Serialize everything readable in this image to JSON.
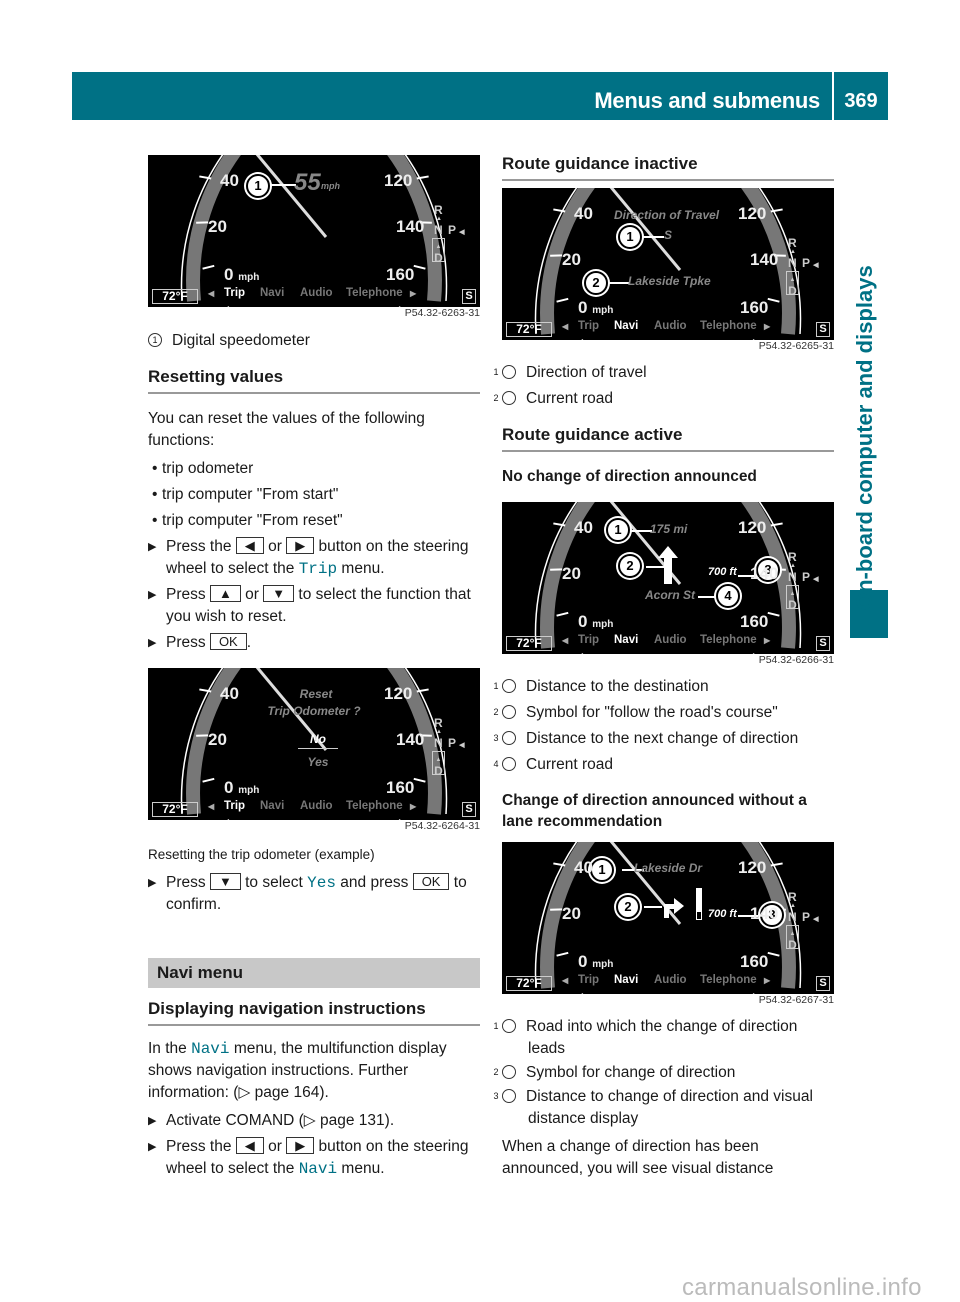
{
  "header": {
    "title": "Menus and submenus",
    "page": "369"
  },
  "side_tab": {
    "label": "On-board computer and displays"
  },
  "dashboard_common": {
    "ticks": {
      "left": [
        "40",
        "20",
        "0"
      ],
      "right": [
        "120",
        "140",
        "160"
      ],
      "unit": "mph"
    },
    "temperature": "72°F",
    "menu": [
      "Trip",
      "Navi",
      "Audio",
      "Telephone"
    ],
    "gear": {
      "r": "R",
      "n": "N",
      "p": "P",
      "d": "D"
    },
    "s_label": "S"
  },
  "left": {
    "fig1": {
      "code": "P54.32-6263-31",
      "active_menu": "Trip",
      "speed": "55",
      "speed_unit": "mph",
      "callouts": [
        "1"
      ]
    },
    "fig1_legend": [
      {
        "num": "1",
        "text": "Digital speedometer"
      }
    ],
    "resetting": {
      "heading": "Resetting values",
      "intro": "You can reset the values of the following functions:",
      "bullets": [
        "trip odometer",
        "trip computer \"From start\"",
        "trip computer \"From reset\""
      ],
      "step1": {
        "pre": "Press the",
        "key_left": "◀",
        "or": "or",
        "key_right": "▶",
        "post": "button on the steering wheel to select the",
        "menu": "Trip",
        "end": "menu."
      },
      "step2": {
        "pre": "Press",
        "key_up": "▲",
        "or": "or",
        "key_down": "▼",
        "post": "to select the function that you wish to reset."
      },
      "step3": {
        "pre": "Press",
        "key_ok": "OK",
        "end": "."
      }
    },
    "fig2": {
      "code": "P54.32-6264-31",
      "active_menu": "Trip",
      "prompt_line1": "Reset",
      "prompt_line2": "Trip Odometer ?",
      "option_no": "No",
      "option_yes": "Yes"
    },
    "fig2_caption": "Resetting the trip odometer (example)",
    "step4": {
      "pre": "Press",
      "key_down": "▼",
      "mid": "to select",
      "value": "Yes",
      "mid2": "and press",
      "key_ok": "OK",
      "post": "to confirm."
    },
    "navi_banner": "Navi menu",
    "displaying": {
      "heading": "Displaying navigation instructions",
      "intro_pre": "In the",
      "intro_menu": "Navi",
      "intro_post": "menu, the multifunction display shows navigation instructions. Further information: (▷ page 164).",
      "step1": "Activate COMAND (▷ page 131).",
      "step2": {
        "pre": "Press the",
        "key_left": "◀",
        "or": "or",
        "key_right": "▶",
        "post": "button on the steering wheel to select the",
        "menu": "Navi",
        "end": "menu."
      }
    }
  },
  "right": {
    "inactive": {
      "heading": "Route guidance inactive",
      "fig": {
        "code": "P54.32-6265-31",
        "active_menu": "Navi",
        "title": "Direction of Travel",
        "direction": "S",
        "road": "Lakeside Tpke"
      },
      "legend": [
        {
          "num": "1",
          "text": "Direction of travel"
        },
        {
          "num": "2",
          "text": "Current road"
        }
      ]
    },
    "active": {
      "heading": "Route guidance active",
      "no_change": {
        "heading": "No change of direction announced",
        "fig": {
          "code": "P54.32-6266-31",
          "active_menu": "Navi",
          "distance_dest": "175 mi",
          "distance_next": "700 ft",
          "road": "Acorn St"
        },
        "legend": [
          {
            "num": "1",
            "text": "Distance to the destination"
          },
          {
            "num": "2",
            "text": "Symbol for \"follow the road's course\""
          },
          {
            "num": "3",
            "text": "Distance to the next change of direction"
          },
          {
            "num": "4",
            "text": "Current road"
          }
        ]
      },
      "change": {
        "heading": "Change of direction announced without a lane recommendation",
        "fig": {
          "code": "P54.32-6267-31",
          "active_menu": "Navi",
          "road": "Lakeside Dr",
          "distance": "700 ft",
          "distance_bar_fill": 0.75
        },
        "legend": [
          {
            "num": "1",
            "text": "Road into which the change of direction leads"
          },
          {
            "num": "2",
            "text": "Symbol for change of direction"
          },
          {
            "num": "3",
            "text": "Distance to change of direction and visual distance display"
          }
        ],
        "paragraph": "When a change of direction has been announced, you will see visual distance"
      }
    }
  },
  "watermark": "carmanualsonline.info"
}
